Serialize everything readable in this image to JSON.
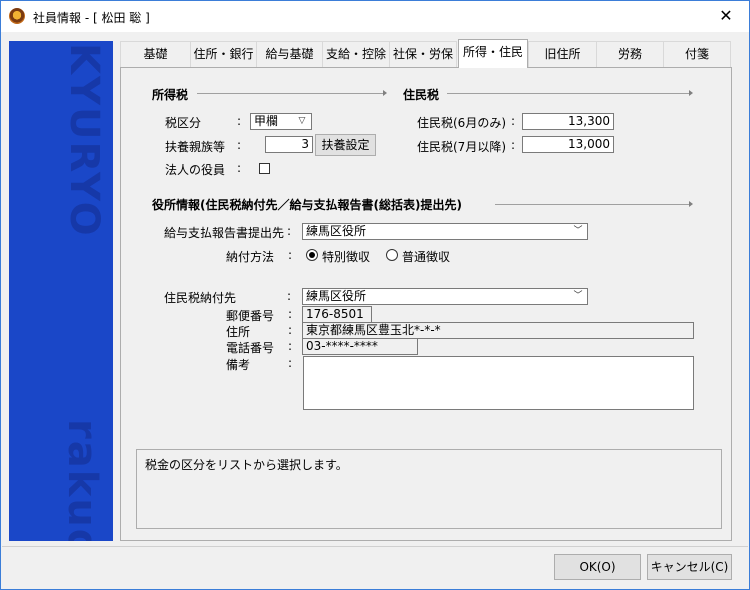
{
  "window": {
    "title": "社員情報 - [ 松田 聡 ]",
    "close_label": "✕",
    "app_icon": "mascot-icon",
    "side_text_top": "KYURYO",
    "side_text_bottom": "rakuda"
  },
  "tabs": [
    {
      "label": "基礎"
    },
    {
      "label": "住所・銀行"
    },
    {
      "label": "給与基礎"
    },
    {
      "label": "支給・控除"
    },
    {
      "label": "社保・労保"
    },
    {
      "label": "所得・住民",
      "active": true
    },
    {
      "label": "旧住所"
    },
    {
      "label": "労務"
    },
    {
      "label": "付箋"
    }
  ],
  "income_tax": {
    "heading": "所得税",
    "tax_class_label": "税区分",
    "tax_class_value": "甲欄",
    "dependents_label": "扶養親族等",
    "dependents_value": "3",
    "dependents_button": "扶養設定",
    "officer_label": "法人の役員",
    "officer_checked": false
  },
  "resident_tax": {
    "heading": "住民税",
    "june_label": "住民税(6月のみ)",
    "june_value": "13,300",
    "july_label": "住民税(7月以降)",
    "july_value": "13,000"
  },
  "office": {
    "heading": "役所情報(住民税納付先／給与支払報告書(総括表)提出先)",
    "report_label": "給与支払報告書提出先",
    "report_value": "練馬区役所",
    "payment_method_label": "納付方法",
    "payment_method_options": [
      "特別徴収",
      "普通徴収"
    ],
    "payment_method_selected": "特別徴収",
    "tax_dest_label": "住民税納付先",
    "tax_dest_value": "練馬区役所",
    "postal_label": "郵便番号",
    "postal_value": "176-8501",
    "address_label": "住所",
    "address_value": "東京都練馬区豊玉北*-*-*",
    "phone_label": "電話番号",
    "phone_value": "03-****-****",
    "notes_label": "備考",
    "notes_value": ""
  },
  "colon": ":",
  "help_text": "税金の区分をリストから選択します。",
  "footer": {
    "ok_label": "OK(O)",
    "cancel_label": "キャンセル(C)"
  },
  "colors": {
    "side_panel": "#1a47c8",
    "window_border": "#3b7dd8"
  }
}
